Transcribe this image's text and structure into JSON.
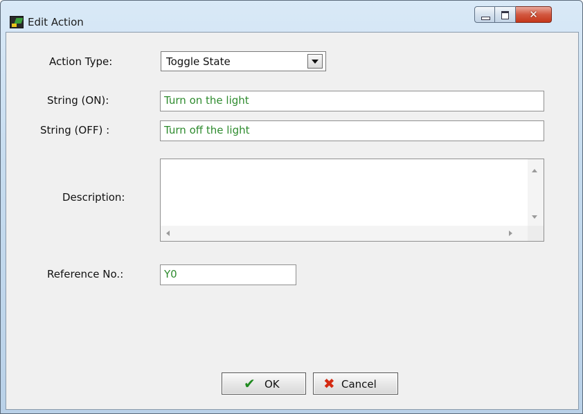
{
  "window": {
    "title": "Edit Action"
  },
  "form": {
    "action_type_label": "Action Type:",
    "action_type_value": "Toggle State",
    "string_on_label": "String (ON):",
    "string_on_value": "Turn on the light",
    "string_off_label": "String (OFF) :",
    "string_off_value": "Turn off the light",
    "description_label": "Description:",
    "description_value": "",
    "reference_label": "Reference No.:",
    "reference_value": "Y0"
  },
  "buttons": {
    "ok_label": "OK",
    "cancel_label": "Cancel"
  },
  "icons": {
    "app": "app-icon",
    "minimize": "minimize-icon",
    "maximize": "maximize-icon",
    "close": "close-icon",
    "ok": "checkmark-icon",
    "cancel": "x-icon"
  },
  "colors": {
    "field_text": "#2e8b2e",
    "ok_glyph": "#1f8a1f",
    "cancel_glyph": "#d42a12"
  }
}
